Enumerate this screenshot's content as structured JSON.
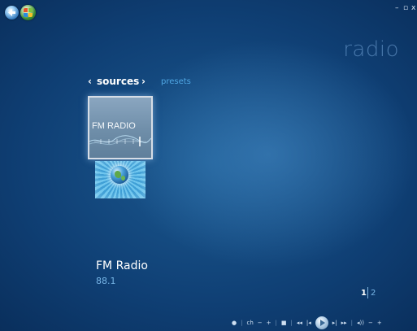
{
  "window": {
    "title": "radio",
    "minimize_label": "–",
    "restore_label": "▫",
    "close_label": "x"
  },
  "nav": {
    "prev_arrow": "‹",
    "current_pivot": "sources",
    "next_arrow": "›",
    "other_pivot": "presets"
  },
  "tiles": [
    {
      "label": "FM RADIO",
      "icon": "radio-wave-icon",
      "selected": true
    },
    {
      "label": "",
      "icon": "globe-icon",
      "selected": false
    }
  ],
  "selected": {
    "name": "FM Radio",
    "frequency": "88.1"
  },
  "pagination": {
    "current": "1",
    "next": "2"
  },
  "transport": {
    "record": "●",
    "ch_label": "ch",
    "ch_minus": "−",
    "ch_plus": "+",
    "stop": "■",
    "rewind": "◂◂",
    "prev": "|◂",
    "next": "▸|",
    "fast_forward": "▸▸",
    "volume_icon": "◂))",
    "vol_minus": "−",
    "vol_plus": "+"
  },
  "colors": {
    "accent": "#4fa6e3",
    "background": "#1c5a91",
    "secondary_text": "#78b7e8"
  }
}
